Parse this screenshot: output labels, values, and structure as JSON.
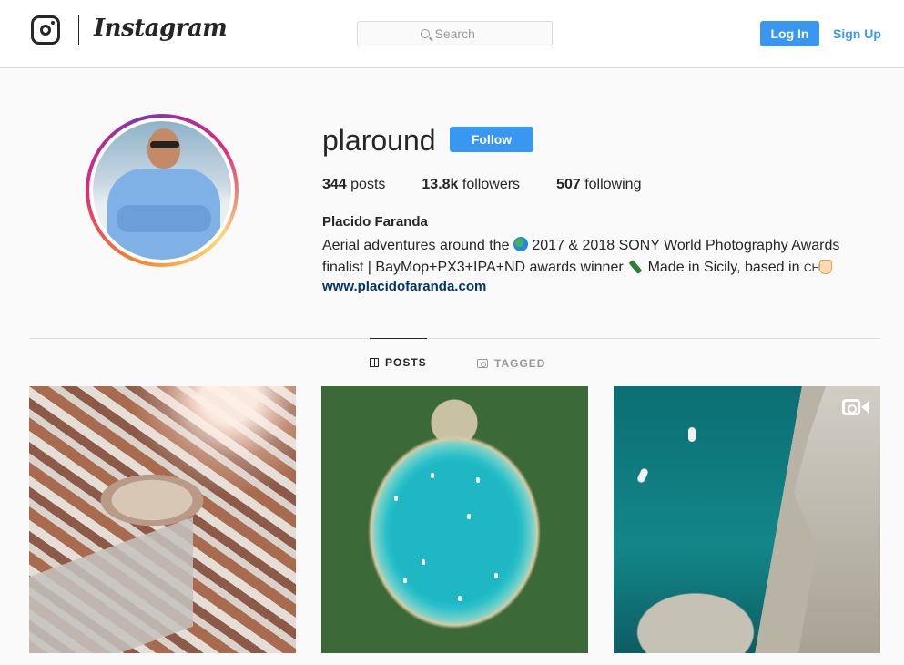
{
  "nav": {
    "wordmark": "Instagram",
    "search_placeholder": "Search",
    "login_label": "Log In",
    "signup_label": "Sign Up"
  },
  "profile": {
    "username": "plaround",
    "follow_label": "Follow",
    "stats": {
      "posts_count": "344",
      "posts_label": "posts",
      "followers_count": "13.8k",
      "followers_label": "followers",
      "following_count": "507",
      "following_label": "following"
    },
    "full_name": "Placido Faranda",
    "bio": {
      "part1": "Aerial adventures around the ",
      "part2": " 2017 & 2018 SONY World Photography Awards finalist | BayMop+PX3+IPA+ND awards winner ",
      "part3": " Made in Sicily, based in ",
      "part4": "CH"
    },
    "website": "www.placidofaranda.com"
  },
  "tabs": [
    {
      "label": "POSTS",
      "active": true
    },
    {
      "label": "TAGGED",
      "active": false
    }
  ],
  "posts": [
    {
      "type": "photo"
    },
    {
      "type": "photo"
    },
    {
      "type": "video"
    }
  ],
  "colors": {
    "accent": "#3897f0",
    "link": "#003569",
    "border": "#dbdbdb",
    "background": "#fafafa"
  }
}
